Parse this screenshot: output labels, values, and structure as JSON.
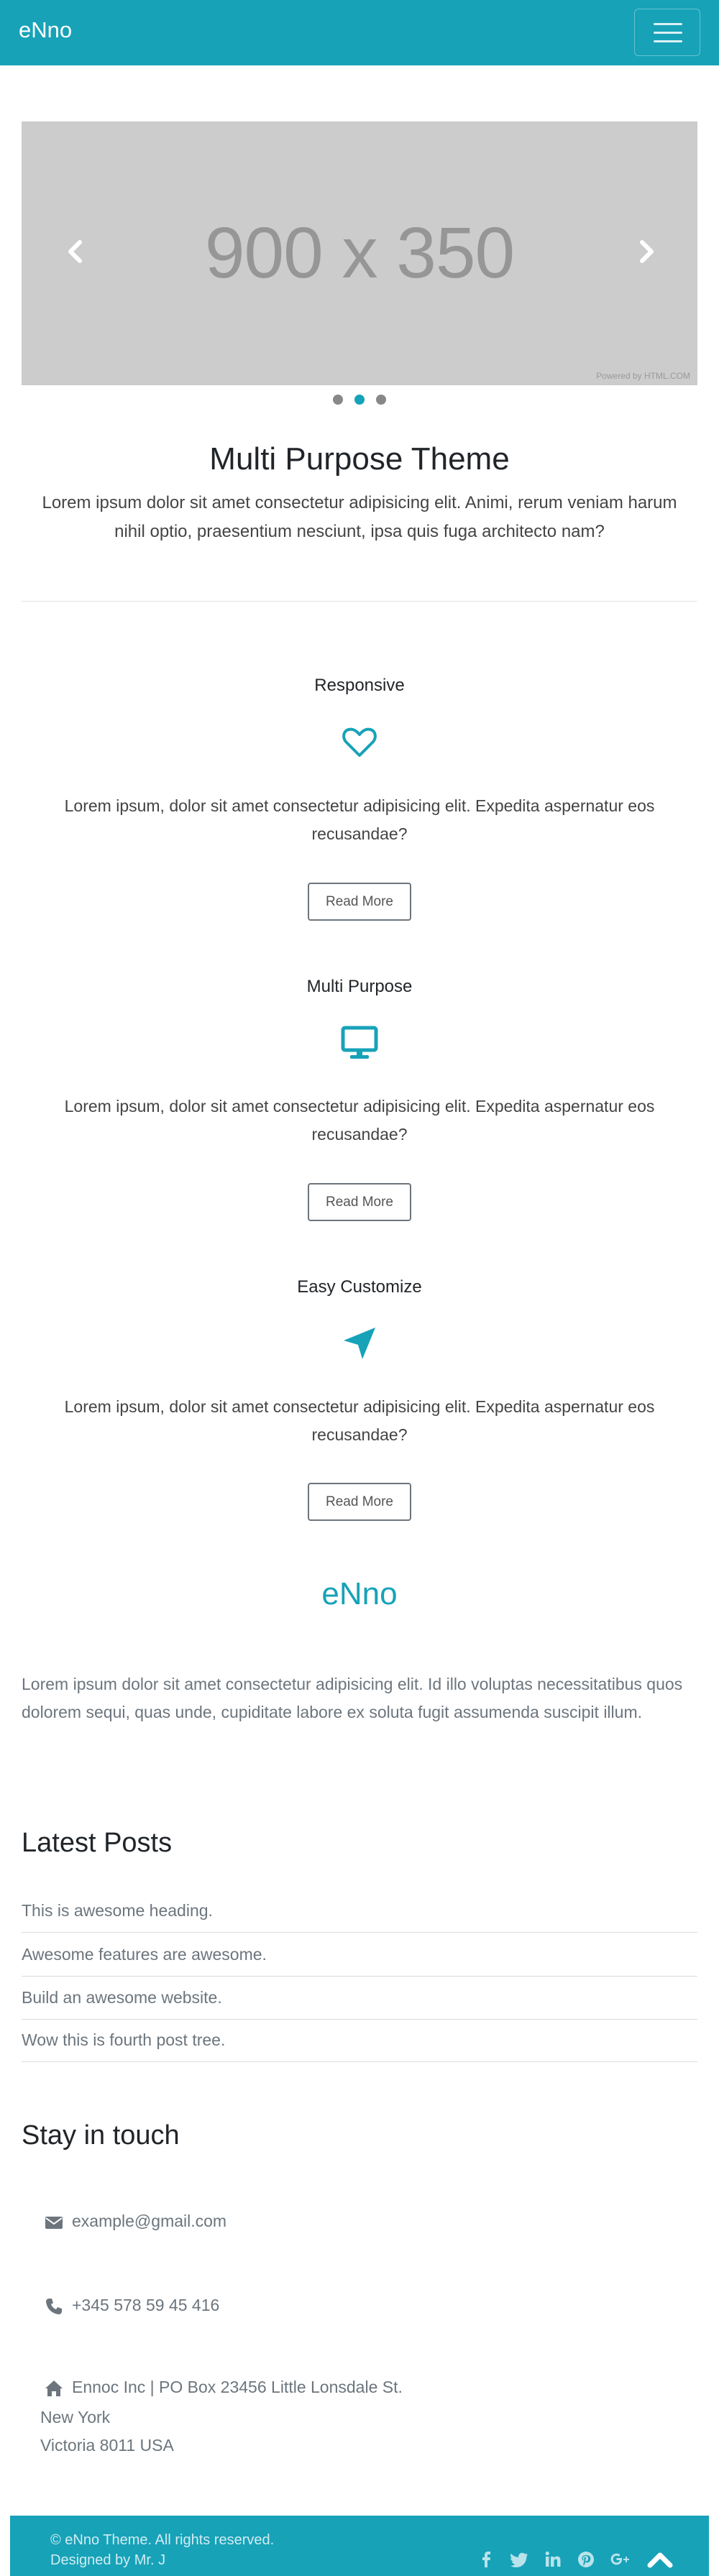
{
  "navbar": {
    "brand": "eNno",
    "toggle_icon": "hamburger-icon",
    "bg_color": "#17a2b8"
  },
  "carousel": {
    "placeholder_text": "900 x 350",
    "powered_by": "Powered by HTML.COM",
    "prev_icon": "chevron-left-icon",
    "next_icon": "chevron-right-icon",
    "slide_count": 3,
    "active_slide": 2
  },
  "intro": {
    "title": "Multi Purpose Theme",
    "text": "Lorem ipsum dolor sit amet consectetur adipisicing elit. Animi, rerum veniam harum nihil optio, praesentium nesciunt, ipsa quis fuga architecto nam?"
  },
  "features": [
    {
      "title": "Responsive",
      "icon": "heart-icon",
      "text": "Lorem ipsum, dolor sit amet consectetur adipisicing elit. Expedita aspernatur eos recusandae?",
      "button": "Read More"
    },
    {
      "title": "Multi Purpose",
      "icon": "desktop-icon",
      "text": "Lorem ipsum, dolor sit amet consectetur adipisicing elit. Expedita aspernatur eos recusandae?",
      "button": "Read More"
    },
    {
      "title": "Easy Customize",
      "icon": "location-arrow-icon",
      "text": "Lorem ipsum, dolor sit amet consectetur adipisicing elit. Expedita aspernatur eos recusandae?",
      "button": "Read More"
    }
  ],
  "about": {
    "title": "eNno",
    "text": "Lorem ipsum dolor sit amet consectetur adipisicing elit. Id illo voluptas necessitatibus quos dolorem sequi, quas unde, cupiditate labore ex soluta fugit assumenda suscipit illum."
  },
  "posts": {
    "title": "Latest Posts",
    "items": [
      "This is awesome heading.",
      "Awesome features are awesome.",
      "Build an awesome website.",
      "Wow this is fourth post tree."
    ]
  },
  "contact": {
    "title": "Stay in touch",
    "email": "example@gmail.com",
    "phone": "+345 578 59 45 416",
    "address_line1": "Ennoc Inc | PO Box 23456 Little Lonsdale St.",
    "address_line2": "New York",
    "address_line3": "Victoria 8011 USA"
  },
  "footer": {
    "copyright": "© eNno Theme. All rights reserved.",
    "designed_by": "Designed by Mr. J",
    "social_icons": [
      "facebook-icon",
      "twitter-icon",
      "linkedin-icon",
      "pinterest-icon",
      "google-plus-icon"
    ],
    "up_icon": "chevron-up-icon"
  },
  "colors": {
    "accent": "#17a2b8",
    "text_muted": "#6c757d"
  }
}
